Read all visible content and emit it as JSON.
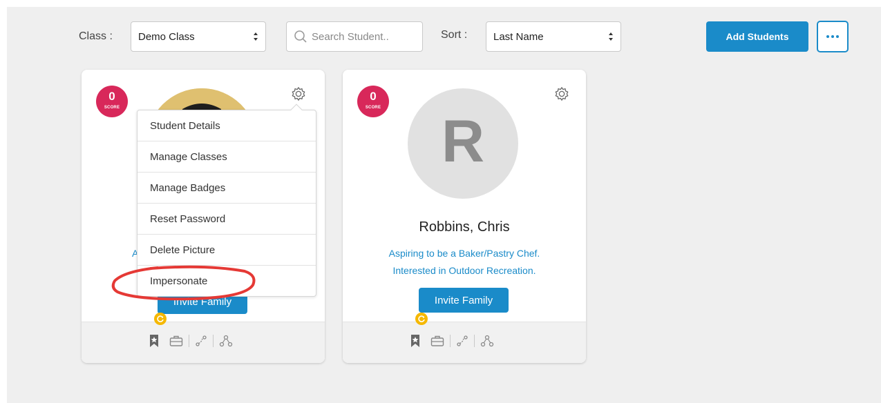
{
  "toolbar": {
    "class_label": "Class :",
    "class_value": "Demo Class",
    "search_placeholder": "Search Student..",
    "sort_label": "Sort :",
    "sort_value": "Last Name",
    "add_students_label": "Add Students"
  },
  "cards": [
    {
      "score": "0",
      "score_label": "SCORE",
      "aspire_partial": "A",
      "invite_label": "Invite Family"
    },
    {
      "score": "0",
      "score_label": "SCORE",
      "initial": "R",
      "name": "Robbins, Chris",
      "aspire_line1": "Aspiring to be a Baker/Pastry Chef.",
      "aspire_line2": "Interested in Outdoor Recreation.",
      "invite_label": "Invite Family"
    }
  ],
  "menu": {
    "items": [
      {
        "label": "Student Details"
      },
      {
        "label": "Manage Classes"
      },
      {
        "label": "Manage Badges"
      },
      {
        "label": "Reset Password"
      },
      {
        "label": "Delete Picture"
      },
      {
        "label": "Impersonate"
      }
    ]
  },
  "colors": {
    "accent": "#1a8bc9",
    "score": "#d8285a",
    "highlight_ring": "#e53935",
    "badge_refresh": "#f5b800",
    "canvas": "#efefef"
  },
  "icons": [
    "select-arrows-icon",
    "search-icon",
    "more-icon",
    "gear-icon",
    "badge-icon",
    "briefcase-icon",
    "pathway-icon",
    "network-icon",
    "refresh-icon"
  ]
}
